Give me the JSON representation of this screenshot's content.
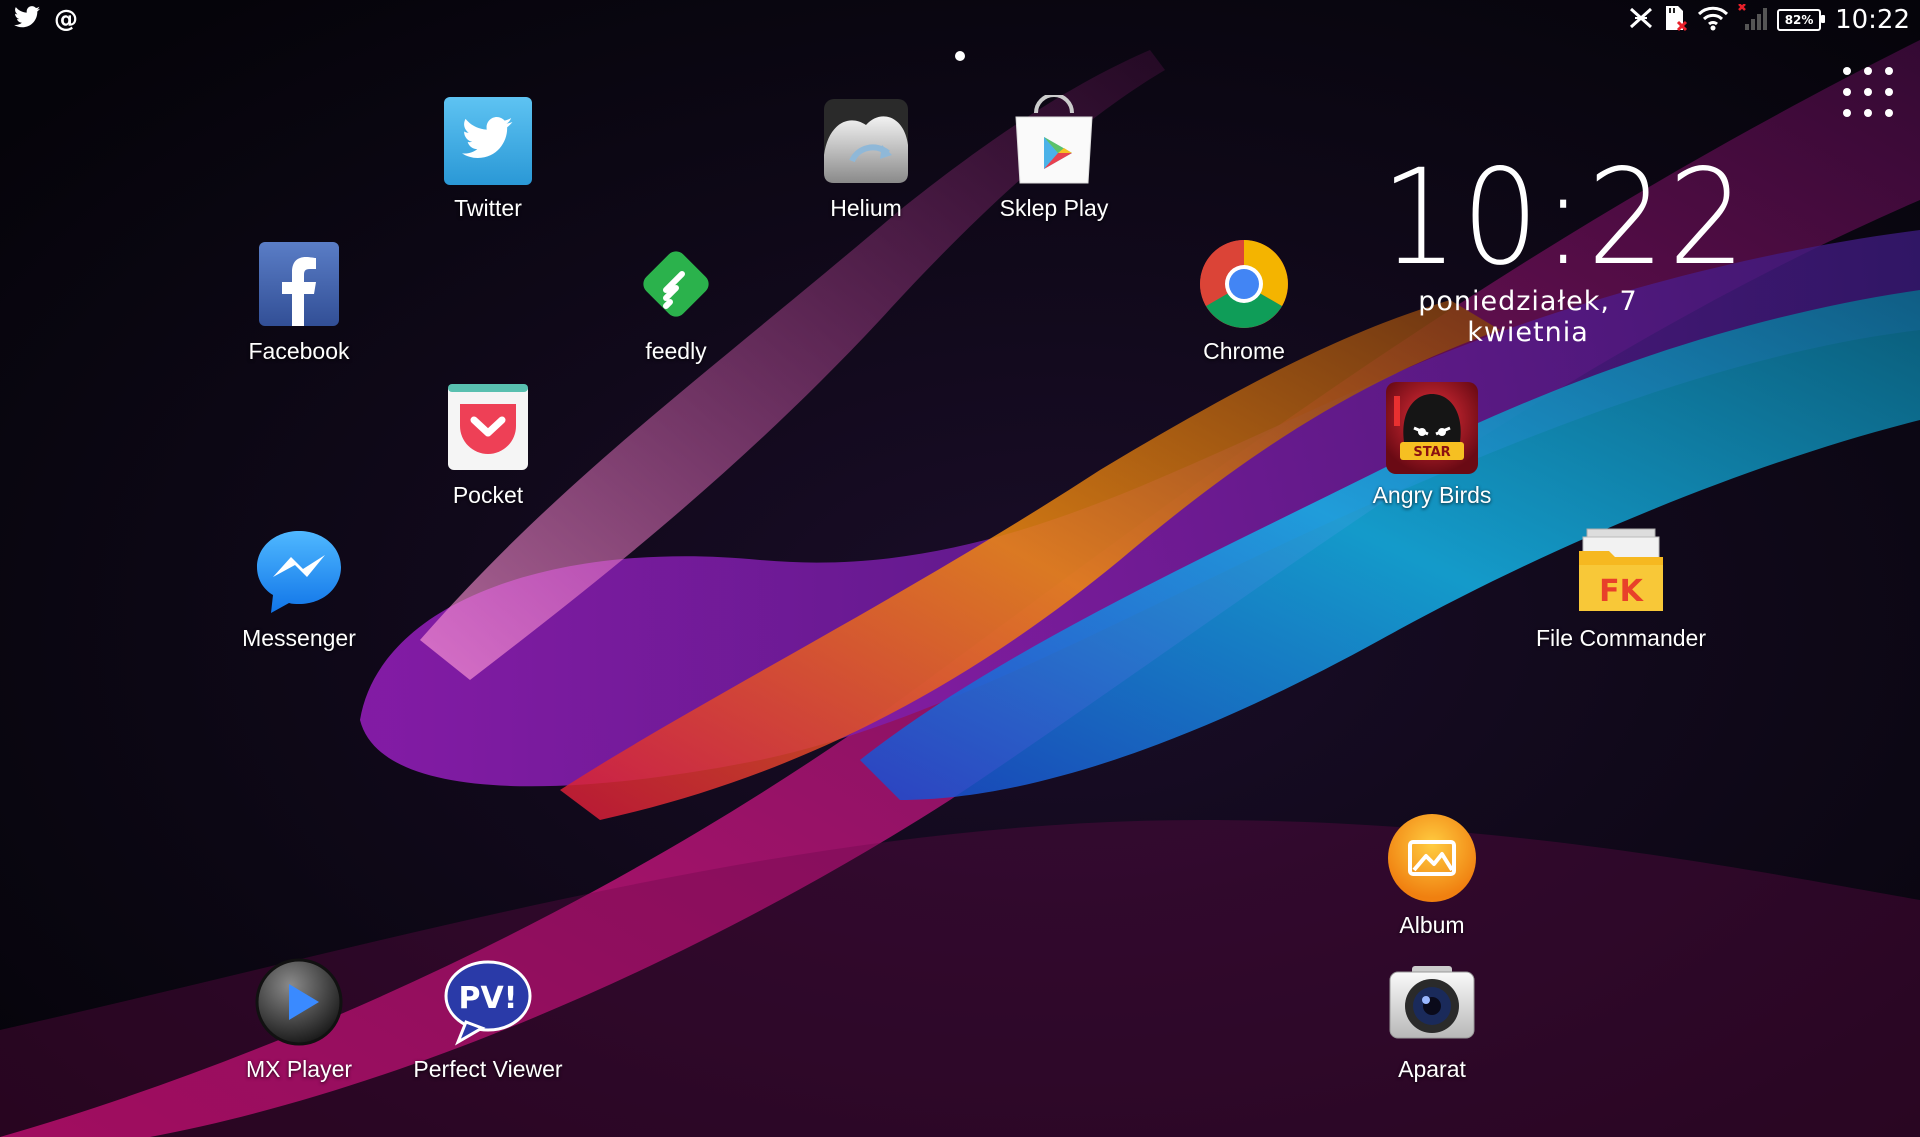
{
  "status_bar": {
    "notification_icons": [
      "twitter-icon",
      "at-sign-icon"
    ],
    "system_icons": [
      "nfc-off-icon",
      "sd-card-error-icon",
      "wifi-icon",
      "cellular-signal-no-service-icon",
      "battery-icon"
    ],
    "battery_level": "82%",
    "time": "10:22"
  },
  "home": {
    "page_indicator_count": 1,
    "apps_button_icon": "apps-grid-icon"
  },
  "clock_widget": {
    "time": "10:22",
    "date": "poniedziałek, 7 kwietnia"
  },
  "apps": {
    "twitter": {
      "label": "Twitter",
      "icon": "twitter-icon"
    },
    "helium": {
      "label": "Helium",
      "icon": "helium-icon"
    },
    "sklep_play": {
      "label": "Sklep Play",
      "icon": "play-store-icon"
    },
    "facebook": {
      "label": "Facebook",
      "icon": "facebook-icon"
    },
    "feedly": {
      "label": "feedly",
      "icon": "feedly-icon"
    },
    "chrome": {
      "label": "Chrome",
      "icon": "chrome-icon"
    },
    "pocket": {
      "label": "Pocket",
      "icon": "pocket-icon"
    },
    "angry_birds": {
      "label": "Angry Birds",
      "icon": "angry-birds-star-wars-icon"
    },
    "messenger": {
      "label": "Messenger",
      "icon": "messenger-icon"
    },
    "file_commander": {
      "label": "File Commander",
      "icon": "file-commander-icon"
    },
    "album": {
      "label": "Album",
      "icon": "album-icon"
    },
    "mx_player": {
      "label": "MX Player",
      "icon": "mx-player-icon"
    },
    "perfect_viewer": {
      "label": "Perfect Viewer",
      "icon": "perfect-viewer-icon"
    },
    "aparat": {
      "label": "Aparat",
      "icon": "camera-icon"
    }
  },
  "colors": {
    "background": "#07060c",
    "wallpaper_magenta": "#c3137a",
    "wallpaper_purple": "#7a1fb0",
    "wallpaper_orange": "#e0700a",
    "wallpaper_cyan": "#18a8e0",
    "text": "#ffffff"
  }
}
